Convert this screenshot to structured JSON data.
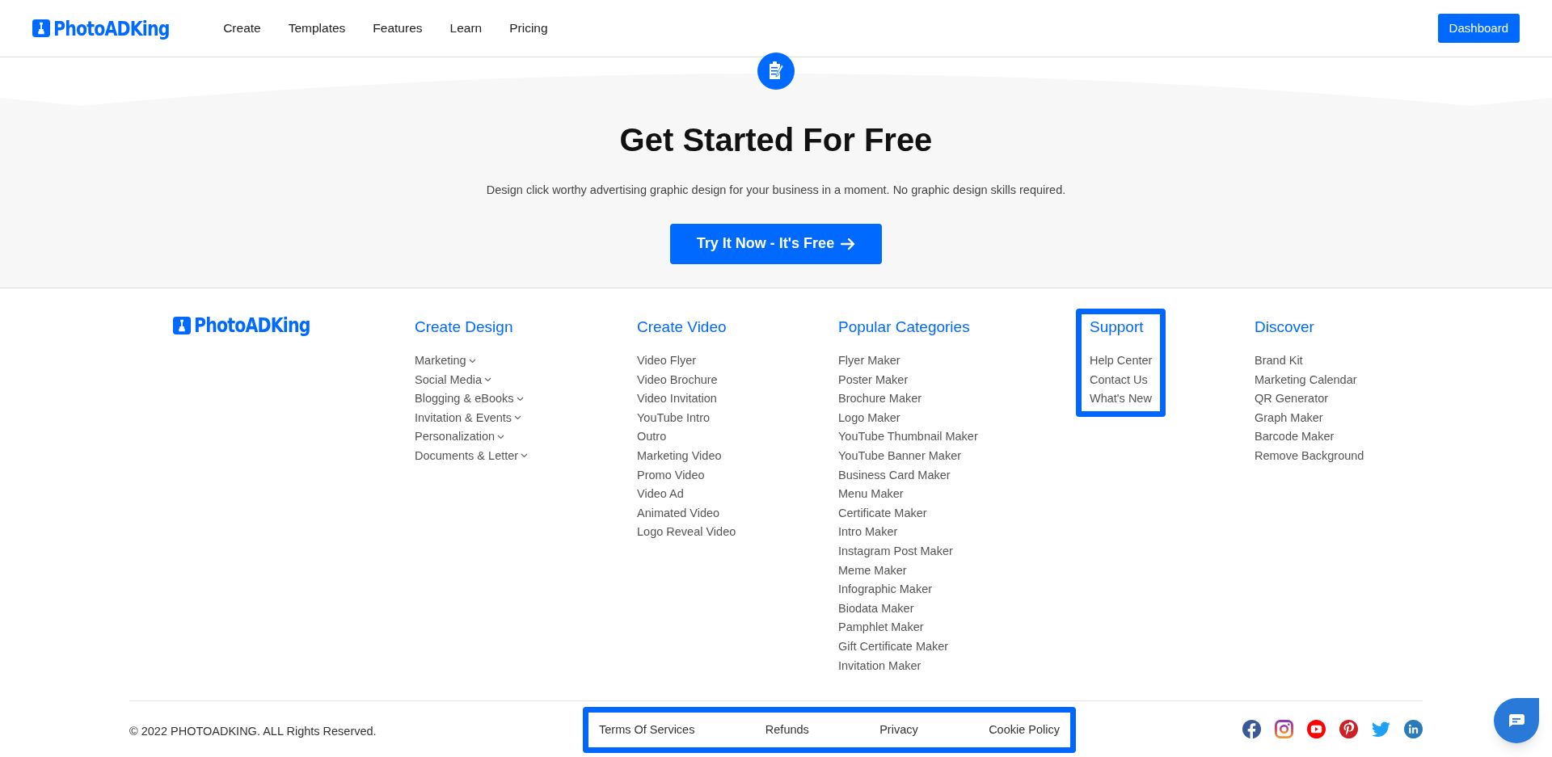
{
  "header": {
    "logo": "PhotoADKing",
    "nav": [
      "Create",
      "Templates",
      "Features",
      "Learn",
      "Pricing"
    ],
    "dashboard_button": "Dashboard"
  },
  "hero": {
    "title": "Get Started For Free",
    "subtitle": "Design click worthy advertising graphic design for your business in a moment. No graphic design skills required.",
    "cta": "Try It Now - It's Free"
  },
  "footer": {
    "logo": "PhotoADKing",
    "columns": [
      {
        "heading": "Create Design",
        "highlighted": false,
        "items": [
          {
            "label": "Marketing",
            "expandable": true
          },
          {
            "label": "Social Media",
            "expandable": true
          },
          {
            "label": "Blogging & eBooks",
            "expandable": true
          },
          {
            "label": "Invitation & Events",
            "expandable": true
          },
          {
            "label": "Personalization",
            "expandable": true
          },
          {
            "label": "Documents & Letter",
            "expandable": true
          }
        ]
      },
      {
        "heading": "Create Video",
        "highlighted": false,
        "items": [
          {
            "label": "Video Flyer",
            "expandable": false
          },
          {
            "label": "Video Brochure",
            "expandable": false
          },
          {
            "label": "Video Invitation",
            "expandable": false
          },
          {
            "label": "YouTube Intro",
            "expandable": false
          },
          {
            "label": "Outro",
            "expandable": false
          },
          {
            "label": "Marketing Video",
            "expandable": false
          },
          {
            "label": "Promo Video",
            "expandable": false
          },
          {
            "label": "Video Ad",
            "expandable": false
          },
          {
            "label": "Animated Video",
            "expandable": false
          },
          {
            "label": "Logo Reveal Video",
            "expandable": false
          }
        ]
      },
      {
        "heading": "Popular Categories",
        "highlighted": false,
        "items": [
          {
            "label": "Flyer Maker",
            "expandable": false
          },
          {
            "label": "Poster Maker",
            "expandable": false
          },
          {
            "label": "Brochure Maker",
            "expandable": false
          },
          {
            "label": "Logo Maker",
            "expandable": false
          },
          {
            "label": "YouTube Thumbnail Maker",
            "expandable": false
          },
          {
            "label": "YouTube Banner Maker",
            "expandable": false
          },
          {
            "label": "Business Card Maker",
            "expandable": false
          },
          {
            "label": "Menu Maker",
            "expandable": false
          },
          {
            "label": "Certificate Maker",
            "expandable": false
          },
          {
            "label": "Intro Maker",
            "expandable": false
          },
          {
            "label": "Instagram Post Maker",
            "expandable": false
          },
          {
            "label": "Meme Maker",
            "expandable": false
          },
          {
            "label": "Infographic Maker",
            "expandable": false
          },
          {
            "label": "Biodata Maker",
            "expandable": false
          },
          {
            "label": "Pamphlet Maker",
            "expandable": false
          },
          {
            "label": "Gift Certificate Maker",
            "expandable": false
          },
          {
            "label": "Invitation Maker",
            "expandable": false
          }
        ]
      },
      {
        "heading": "Support",
        "highlighted": true,
        "items": [
          {
            "label": "Help Center",
            "expandable": false
          },
          {
            "label": "Contact Us",
            "expandable": false
          },
          {
            "label": "What's New",
            "expandable": false
          }
        ]
      },
      {
        "heading": "Discover",
        "highlighted": false,
        "items": [
          {
            "label": "Brand Kit",
            "expandable": false
          },
          {
            "label": "Marketing Calendar",
            "expandable": false
          },
          {
            "label": "QR Generator",
            "expandable": false
          },
          {
            "label": "Graph Maker",
            "expandable": false
          },
          {
            "label": "Barcode Maker",
            "expandable": false
          },
          {
            "label": "Remove Background",
            "expandable": false
          }
        ]
      }
    ],
    "copyright": "© 2022 PHOTOADKING. ALL Rights Reserved.",
    "legal_links": {
      "highlighted": true,
      "items": [
        "Terms Of Services",
        "Refunds",
        "Privacy",
        "Cookie Policy"
      ]
    }
  }
}
